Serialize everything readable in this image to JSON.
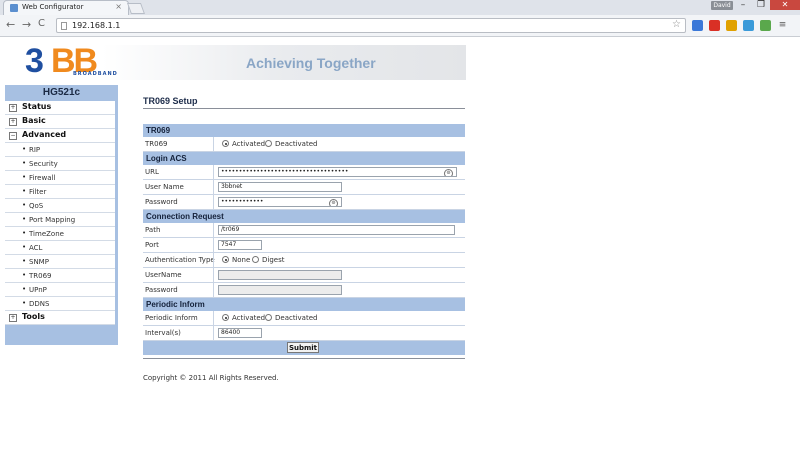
{
  "browser": {
    "tab_title": "Web Configurator",
    "tab_close": "×",
    "address": "192.168.1.1",
    "user_badge": "David",
    "nav_back": "←",
    "nav_forward": "→",
    "nav_reload": "C",
    "star": "☆",
    "window_min": "–",
    "window_restore": "❐",
    "window_close": "✕"
  },
  "banner": {
    "logo_main_3": "3",
    "logo_main_bb": "BB",
    "logo_sub": "BROADBAND",
    "slogan": "Achieving Together"
  },
  "sidebar": {
    "title": "HG521c",
    "items": [
      {
        "type": "top",
        "label": "Status",
        "icon": "+"
      },
      {
        "type": "top",
        "label": "Basic",
        "icon": "+"
      },
      {
        "type": "top",
        "label": "Advanced",
        "icon": "−"
      },
      {
        "type": "sub",
        "label": "RIP"
      },
      {
        "type": "sub",
        "label": "Security"
      },
      {
        "type": "sub",
        "label": "Firewall"
      },
      {
        "type": "sub",
        "label": "Filter"
      },
      {
        "type": "sub",
        "label": "QoS"
      },
      {
        "type": "sub",
        "label": "Port Mapping"
      },
      {
        "type": "sub",
        "label": "TimeZone"
      },
      {
        "type": "sub",
        "label": "ACL"
      },
      {
        "type": "sub",
        "label": "SNMP"
      },
      {
        "type": "sub",
        "label": "TR069"
      },
      {
        "type": "sub",
        "label": "UPnP"
      },
      {
        "type": "sub",
        "label": "DDNS"
      },
      {
        "type": "top",
        "label": "Tools",
        "icon": "+"
      }
    ]
  },
  "main": {
    "title": "TR069 Setup",
    "sections": {
      "tr069": "TR069",
      "login_acs": "Login ACS",
      "connection_request": "Connection Request",
      "periodic_inform": "Periodic Inform"
    },
    "tr069": {
      "label": "TR069",
      "opt_activated": "Activated",
      "opt_deactivated": "Deactivated"
    },
    "login_acs": {
      "url_label": "URL",
      "url_value": "••••••••••••••••••••••••••••••••••••",
      "username_label": "User Name",
      "username_value": "3bbnet",
      "password_label": "Password",
      "password_value": "••••••••••••"
    },
    "connection_request": {
      "path_label": "Path",
      "path_value": "/tr069",
      "port_label": "Port",
      "port_value": "7547",
      "auth_label": "Authentication Type",
      "auth_none": "None",
      "auth_digest": "Digest",
      "username_label": "UserName",
      "password_label": "Password"
    },
    "periodic_inform": {
      "label": "Periodic Inform",
      "opt_activated": "Activated",
      "opt_deactivated": "Deactivated",
      "interval_label": "Interval(s)",
      "interval_value": "86400"
    },
    "submit_label": "Submit",
    "copyright": "Copyright © 2011 All Rights Reserved."
  }
}
